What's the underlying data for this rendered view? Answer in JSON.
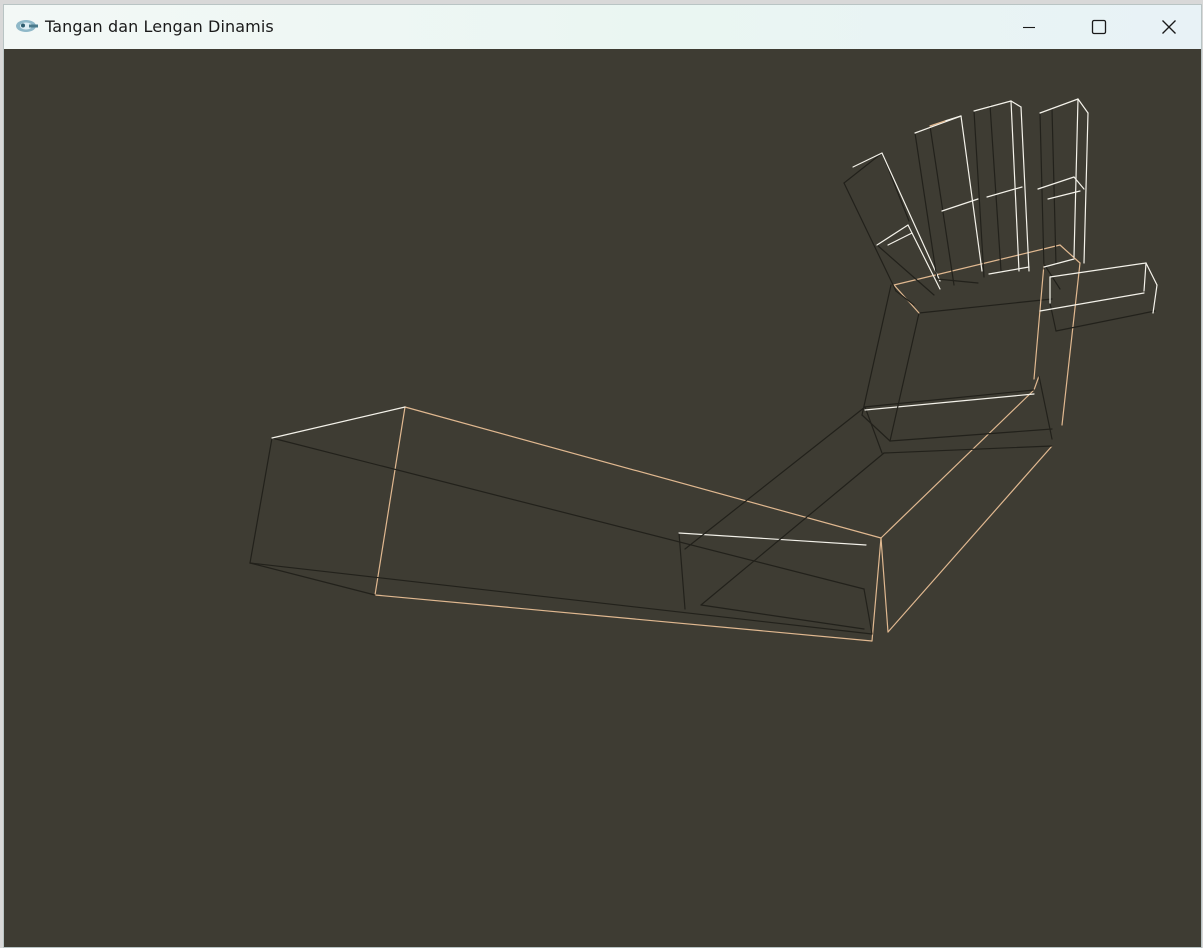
{
  "window": {
    "title": "Tangan dan Lengan Dinamis"
  },
  "titlebar": {
    "icon": "opengl-glut-app-icon",
    "buttons": [
      {
        "name": "minimize",
        "icon": "minimize-icon"
      },
      {
        "name": "maximize",
        "icon": "maximize-icon"
      },
      {
        "name": "close",
        "icon": "close-icon"
      }
    ]
  },
  "viewport": {
    "background_color": "#3e3c33",
    "wire_color_dark": "#22211b",
    "wire_color_peach": "#e0b890",
    "wire_color_white": "#f4f2ea"
  }
}
